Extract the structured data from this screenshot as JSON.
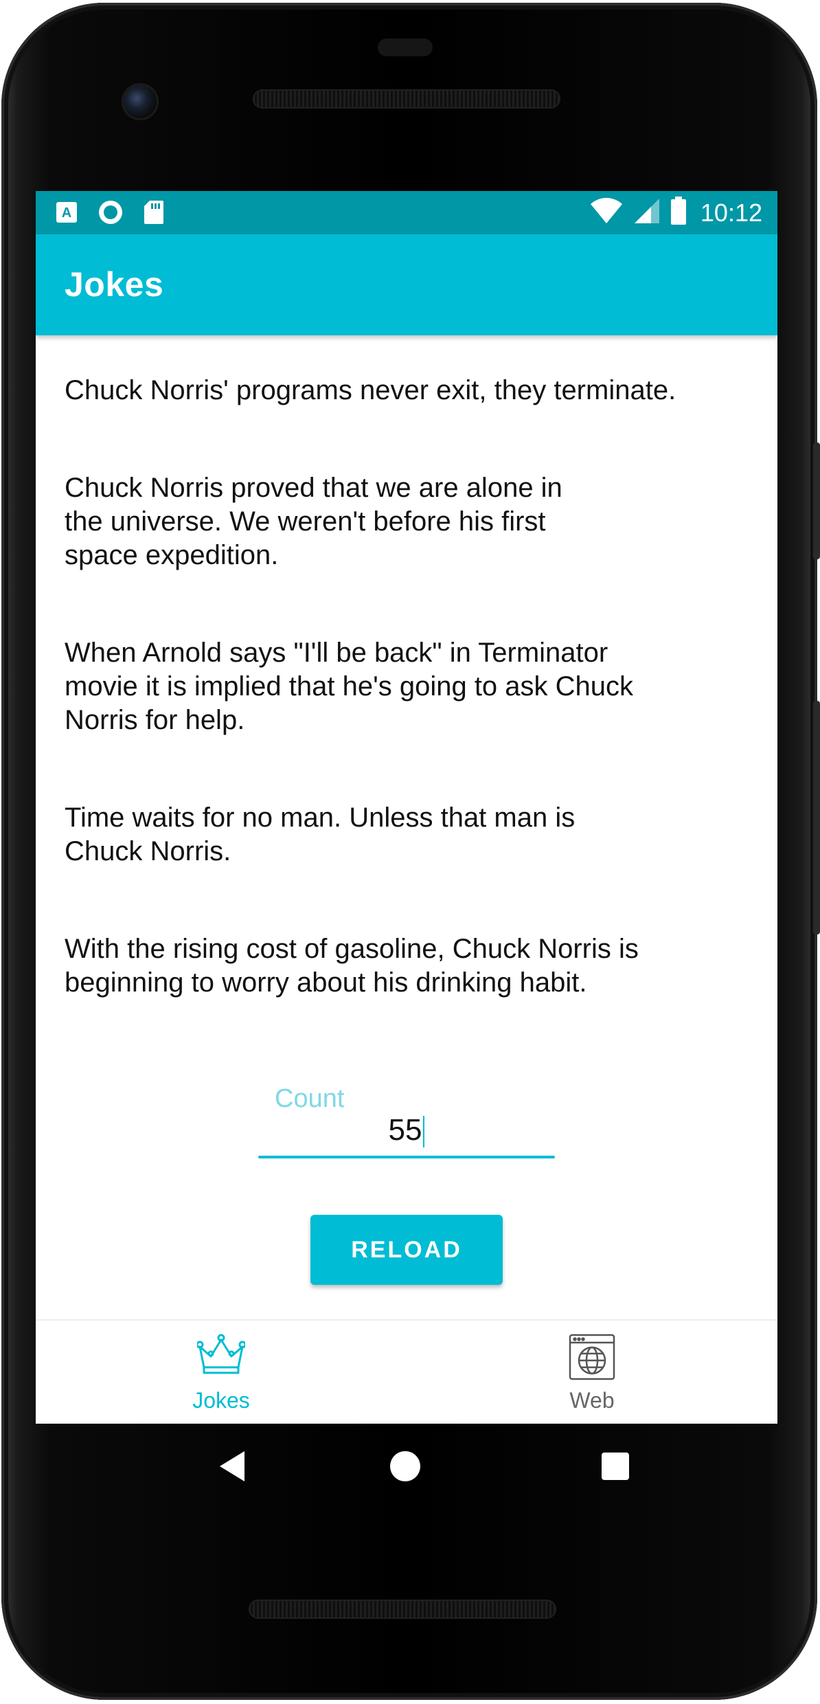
{
  "status_bar": {
    "time": "10:12",
    "icons_left": [
      "a-notification-icon",
      "circle-notification-icon",
      "sd-card-icon"
    ],
    "icons_right": [
      "wifi-icon",
      "cell-signal-icon",
      "battery-icon"
    ]
  },
  "app_bar": {
    "title": "Jokes"
  },
  "jokes": [
    "Chuck Norris' programs never exit, they terminate.",
    "Chuck Norris proved that we are alone in the universe. We weren't before his first space expedition.",
    "When Arnold says \"I'll be back\" in Terminator movie it is implied that he's going to ask Chuck Norris for help.",
    "Time waits for no man. Unless that man is Chuck Norris.",
    "With the rising cost of gasoline, Chuck Norris is beginning to worry about his drinking habit."
  ],
  "count_field": {
    "label": "Count",
    "value": "55"
  },
  "reload_button": {
    "label": "RELOAD"
  },
  "bottom_nav": {
    "items": [
      {
        "label": "Jokes",
        "icon": "crown-icon",
        "selected": true
      },
      {
        "label": "Web",
        "icon": "globe-browser-icon",
        "selected": false
      }
    ]
  },
  "colors": {
    "primary": "#00bcd4",
    "primary_dark": "#0097a7",
    "inactive": "#666666"
  }
}
